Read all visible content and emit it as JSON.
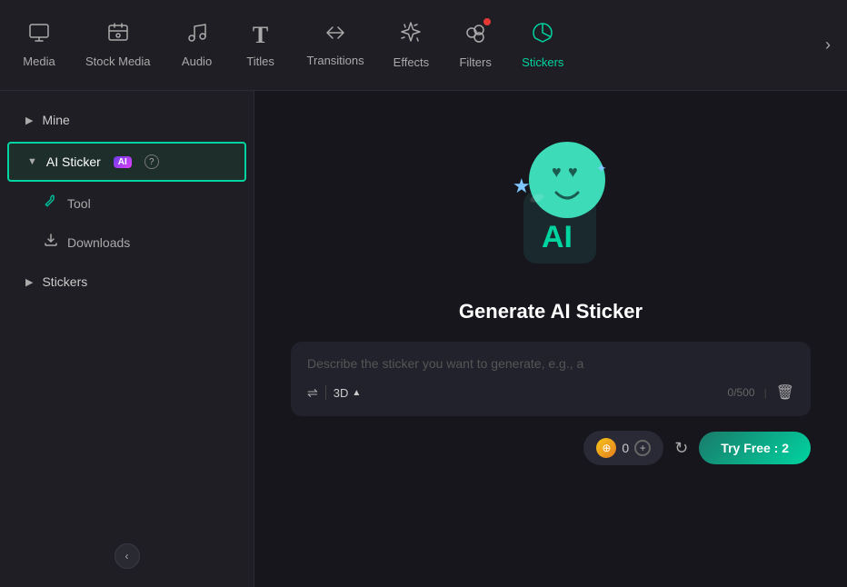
{
  "nav": {
    "items": [
      {
        "id": "media",
        "label": "Media",
        "icon": "🖼",
        "active": false
      },
      {
        "id": "stock-media",
        "label": "Stock Media",
        "icon": "📷",
        "active": false
      },
      {
        "id": "audio",
        "label": "Audio",
        "icon": "🎵",
        "active": false
      },
      {
        "id": "titles",
        "label": "Titles",
        "icon": "T",
        "active": false
      },
      {
        "id": "transitions",
        "label": "Transitions",
        "icon": "↔",
        "active": false
      },
      {
        "id": "effects",
        "label": "Effects",
        "icon": "✨",
        "active": false
      },
      {
        "id": "filters",
        "label": "Filters",
        "icon": "🎨",
        "active": false,
        "dot": true
      },
      {
        "id": "stickers",
        "label": "Stickers",
        "icon": "🖱",
        "active": true
      }
    ],
    "chevron_label": "›"
  },
  "sidebar": {
    "items": [
      {
        "id": "mine",
        "label": "Mine",
        "type": "parent",
        "expanded": false
      },
      {
        "id": "ai-sticker",
        "label": "AI Sticker",
        "type": "parent",
        "expanded": true,
        "active": true,
        "has_ai_badge": true,
        "has_help": true
      },
      {
        "id": "tool",
        "label": "Tool",
        "type": "sub"
      },
      {
        "id": "downloads",
        "label": "Downloads",
        "type": "sub"
      },
      {
        "id": "stickers",
        "label": "Stickers",
        "type": "parent",
        "expanded": false
      }
    ],
    "collapse_icon": "‹"
  },
  "content": {
    "title": "Generate AI Sticker",
    "input_placeholder": "Describe the sticker you want to generate, e.g., a",
    "style_label": "3D",
    "char_count": "0/500",
    "credit_count": "0",
    "try_free_label": "Try Free : 2"
  }
}
